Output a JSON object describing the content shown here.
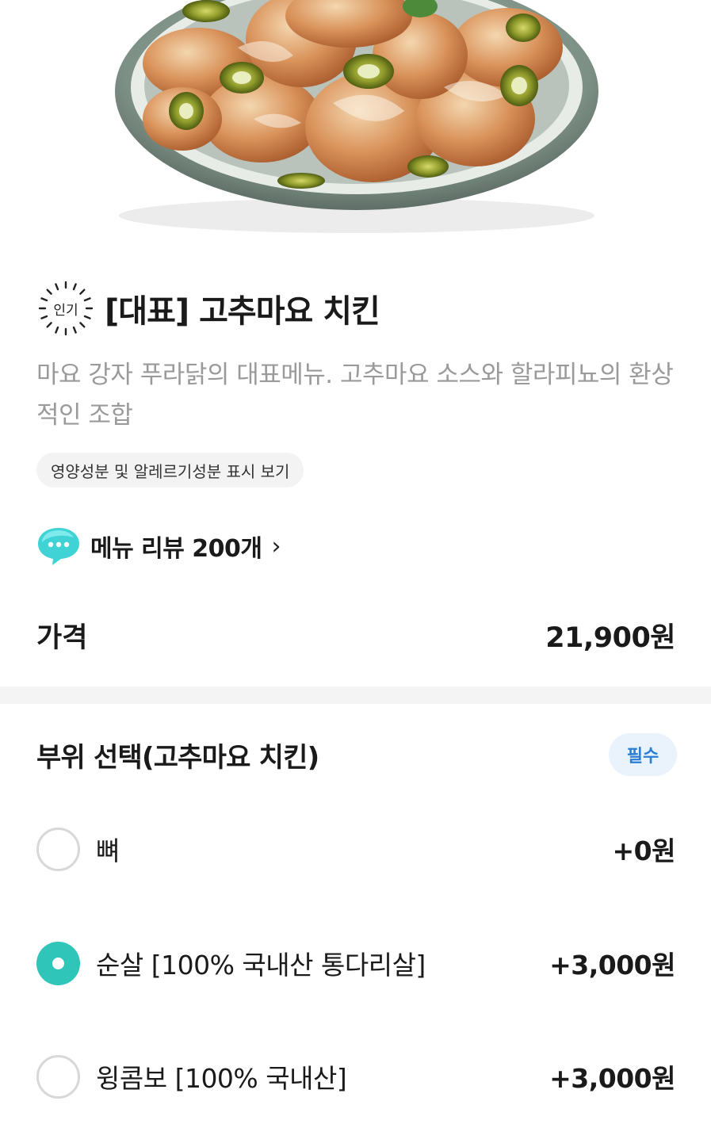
{
  "hero": {
    "image_name": "chicken-plate-photo"
  },
  "header": {
    "badge_text": "인기",
    "title": "[대표] 고추마요 치킨",
    "description": "마요 강자 푸라닭의 대표메뉴. 고추마요 소스와 할라피뇨의 환상적인 조합",
    "nutrition_link": "영양성분 및 알레르기성분 표시 보기"
  },
  "review": {
    "label": "메뉴 리뷰 200개",
    "chevron": "›"
  },
  "price": {
    "label": "가격",
    "value": "21,900원"
  },
  "option_group": {
    "title": "부위 선택(고추마요 치킨)",
    "required_label": "필수",
    "options": [
      {
        "label": "뼈",
        "price": "+0원",
        "selected": false
      },
      {
        "label": "순살 [100% 국내산 통다리살]",
        "price": "+3,000원",
        "selected": true
      },
      {
        "label": "윙콤보 [100% 국내산]",
        "price": "+3,000원",
        "selected": false
      }
    ]
  },
  "colors": {
    "accent": "#30c5b9",
    "required_bg": "#eaf3fc",
    "required_text": "#2a7fd4",
    "divider": "#f4f4f5"
  }
}
